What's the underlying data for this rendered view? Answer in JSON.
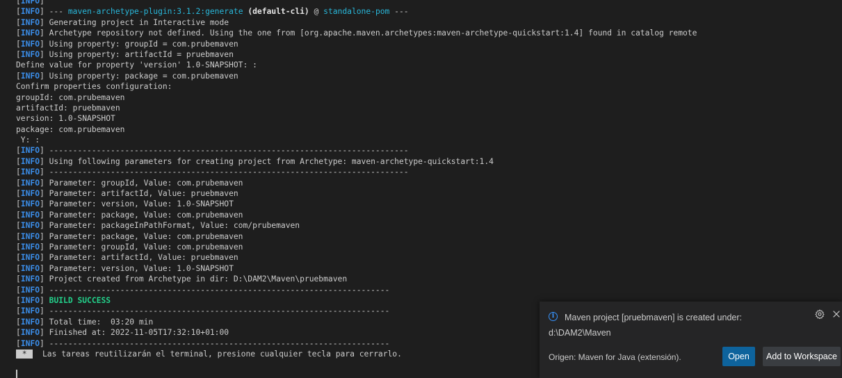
{
  "terminal": {
    "lines": [
      [
        {
          "t": "[",
          "c": "text"
        },
        {
          "t": "INFO",
          "c": "tag"
        },
        {
          "t": "] ",
          "c": "text"
        }
      ],
      [
        {
          "t": "[",
          "c": "text"
        },
        {
          "t": "INFO",
          "c": "tag"
        },
        {
          "t": "] --- ",
          "c": "text"
        },
        {
          "t": "maven-archetype-plugin:3.1.2:generate",
          "c": "cyan"
        },
        {
          "t": " ",
          "c": "text"
        },
        {
          "t": "(default-cli)",
          "c": "bold"
        },
        {
          "t": " @ ",
          "c": "text"
        },
        {
          "t": "standalone-pom",
          "c": "cyan"
        },
        {
          "t": " ---",
          "c": "text"
        }
      ],
      [
        {
          "t": "[",
          "c": "text"
        },
        {
          "t": "INFO",
          "c": "tag"
        },
        {
          "t": "] Generating project in Interactive mode",
          "c": "text"
        }
      ],
      [
        {
          "t": "[",
          "c": "text"
        },
        {
          "t": "INFO",
          "c": "tag"
        },
        {
          "t": "] Archetype repository not defined. Using the one from [org.apache.maven.archetypes:maven-archetype-quickstart:1.4] found in catalog remote",
          "c": "text"
        }
      ],
      [
        {
          "t": "[",
          "c": "text"
        },
        {
          "t": "INFO",
          "c": "tag"
        },
        {
          "t": "] Using property: groupId = com.prubemaven",
          "c": "text"
        }
      ],
      [
        {
          "t": "[",
          "c": "text"
        },
        {
          "t": "INFO",
          "c": "tag"
        },
        {
          "t": "] Using property: artifactId = pruebmaven",
          "c": "text"
        }
      ],
      [
        {
          "t": "Define value for property 'version' 1.0-SNAPSHOT: :",
          "c": "text"
        }
      ],
      [
        {
          "t": "[",
          "c": "text"
        },
        {
          "t": "INFO",
          "c": "tag"
        },
        {
          "t": "] Using property: package = com.prubemaven",
          "c": "text"
        }
      ],
      [
        {
          "t": "Confirm properties configuration:",
          "c": "text"
        }
      ],
      [
        {
          "t": "groupId: com.prubemaven",
          "c": "text"
        }
      ],
      [
        {
          "t": "artifactId: pruebmaven",
          "c": "text"
        }
      ],
      [
        {
          "t": "version: 1.0-SNAPSHOT",
          "c": "text"
        }
      ],
      [
        {
          "t": "package: com.prubemaven",
          "c": "text"
        }
      ],
      [
        {
          "t": " Y: :",
          "c": "text"
        }
      ],
      [
        {
          "t": "[",
          "c": "text"
        },
        {
          "t": "INFO",
          "c": "tag"
        },
        {
          "t": "] ----------------------------------------------------------------------------",
          "c": "text"
        }
      ],
      [
        {
          "t": "[",
          "c": "text"
        },
        {
          "t": "INFO",
          "c": "tag"
        },
        {
          "t": "] Using following parameters for creating project from Archetype: maven-archetype-quickstart:1.4",
          "c": "text"
        }
      ],
      [
        {
          "t": "[",
          "c": "text"
        },
        {
          "t": "INFO",
          "c": "tag"
        },
        {
          "t": "] ----------------------------------------------------------------------------",
          "c": "text"
        }
      ],
      [
        {
          "t": "[",
          "c": "text"
        },
        {
          "t": "INFO",
          "c": "tag"
        },
        {
          "t": "] Parameter: groupId, Value: com.prubemaven",
          "c": "text"
        }
      ],
      [
        {
          "t": "[",
          "c": "text"
        },
        {
          "t": "INFO",
          "c": "tag"
        },
        {
          "t": "] Parameter: artifactId, Value: pruebmaven",
          "c": "text"
        }
      ],
      [
        {
          "t": "[",
          "c": "text"
        },
        {
          "t": "INFO",
          "c": "tag"
        },
        {
          "t": "] Parameter: version, Value: 1.0-SNAPSHOT",
          "c": "text"
        }
      ],
      [
        {
          "t": "[",
          "c": "text"
        },
        {
          "t": "INFO",
          "c": "tag"
        },
        {
          "t": "] Parameter: package, Value: com.prubemaven",
          "c": "text"
        }
      ],
      [
        {
          "t": "[",
          "c": "text"
        },
        {
          "t": "INFO",
          "c": "tag"
        },
        {
          "t": "] Parameter: packageInPathFormat, Value: com/prubemaven",
          "c": "text"
        }
      ],
      [
        {
          "t": "[",
          "c": "text"
        },
        {
          "t": "INFO",
          "c": "tag"
        },
        {
          "t": "] Parameter: package, Value: com.prubemaven",
          "c": "text"
        }
      ],
      [
        {
          "t": "[",
          "c": "text"
        },
        {
          "t": "INFO",
          "c": "tag"
        },
        {
          "t": "] Parameter: groupId, Value: com.prubemaven",
          "c": "text"
        }
      ],
      [
        {
          "t": "[",
          "c": "text"
        },
        {
          "t": "INFO",
          "c": "tag"
        },
        {
          "t": "] Parameter: artifactId, Value: pruebmaven",
          "c": "text"
        }
      ],
      [
        {
          "t": "[",
          "c": "text"
        },
        {
          "t": "INFO",
          "c": "tag"
        },
        {
          "t": "] Parameter: version, Value: 1.0-SNAPSHOT",
          "c": "text"
        }
      ],
      [
        {
          "t": "[",
          "c": "text"
        },
        {
          "t": "INFO",
          "c": "tag"
        },
        {
          "t": "] Project created from Archetype in dir: D:\\DAM2\\Maven\\pruebmaven",
          "c": "text"
        }
      ],
      [
        {
          "t": "[",
          "c": "text"
        },
        {
          "t": "INFO",
          "c": "tag"
        },
        {
          "t": "] ------------------------------------------------------------------------",
          "c": "text"
        }
      ],
      [
        {
          "t": "[",
          "c": "text"
        },
        {
          "t": "INFO",
          "c": "tag"
        },
        {
          "t": "] ",
          "c": "text"
        },
        {
          "t": "BUILD SUCCESS",
          "c": "success"
        }
      ],
      [
        {
          "t": "[",
          "c": "text"
        },
        {
          "t": "INFO",
          "c": "tag"
        },
        {
          "t": "] ------------------------------------------------------------------------",
          "c": "text"
        }
      ],
      [
        {
          "t": "[",
          "c": "text"
        },
        {
          "t": "INFO",
          "c": "tag"
        },
        {
          "t": "] Total time:  03:20 min",
          "c": "text"
        }
      ],
      [
        {
          "t": "[",
          "c": "text"
        },
        {
          "t": "INFO",
          "c": "tag"
        },
        {
          "t": "] Finished at: 2022-11-05T17:32:10+01:00",
          "c": "text"
        }
      ],
      [
        {
          "t": "[",
          "c": "text"
        },
        {
          "t": "INFO",
          "c": "tag"
        },
        {
          "t": "] ------------------------------------------------------------------------",
          "c": "text"
        }
      ],
      [
        {
          "t": " * ",
          "c": "badge"
        },
        {
          "t": "  Las tareas reutilizarán el terminal, presione cualquier tecla para cerrarlo.",
          "c": "text"
        }
      ]
    ]
  },
  "notification": {
    "icon": "info-icon",
    "message_line1": "Maven project [pruebmaven] is created under:",
    "message_line2": "d:\\DAM2\\Maven",
    "source": "Origen: Maven for Java (extensión).",
    "open_label": "Open",
    "add_label": "Add to Workspace",
    "info_glyph": "i",
    "gear_icon": "gear-icon",
    "close_icon": "close-icon"
  },
  "colors": {
    "background": "#1e1e1e",
    "tag": "#3b8eea",
    "cyan": "#29b8db",
    "success": "#23d18b",
    "text": "#cccccc",
    "primary_button": "#0e639c",
    "secondary_button": "#3a3d41"
  }
}
